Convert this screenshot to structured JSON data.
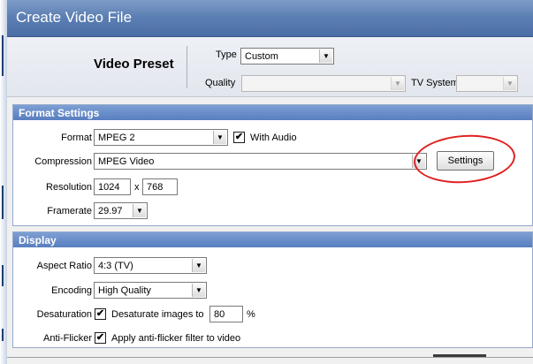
{
  "window": {
    "title": "Create Video File"
  },
  "preset": {
    "title": "Video Preset",
    "type_label": "Type",
    "type_value": "Custom",
    "quality_label": "Quality",
    "quality_value": "",
    "tv_system_label": "TV System",
    "tv_system_value": ""
  },
  "format_settings": {
    "header": "Format Settings",
    "format_label": "Format",
    "format_value": "MPEG 2",
    "with_audio_label": "With Audio",
    "with_audio_checked": true,
    "compression_label": "Compression",
    "compression_value": "MPEG Video",
    "settings_button": "Settings",
    "resolution_label": "Resolution",
    "resolution_width": "1024",
    "resolution_sep": "x",
    "resolution_height": "768",
    "framerate_label": "Framerate",
    "framerate_value": "29.97"
  },
  "display": {
    "header": "Display",
    "aspect_ratio_label": "Aspect Ratio",
    "aspect_ratio_value": "4:3 (TV)",
    "encoding_label": "Encoding",
    "encoding_value": "High Quality",
    "desaturation_label": "Desaturation",
    "desaturate_label": "Desaturate images to",
    "desaturate_checked": true,
    "desaturate_value": "80",
    "desaturate_unit": "%",
    "antiflicker_label": "Anti-Flicker",
    "antiflicker_text": "Apply anti-flicker filter to video",
    "antiflicker_checked": true
  },
  "icons": {
    "dropdown_arrow": "▼",
    "checkmark": "✔"
  },
  "colors": {
    "title_bar": "#5d80b4",
    "group_header": "#6a8fcb",
    "annotation": "#e02020"
  }
}
